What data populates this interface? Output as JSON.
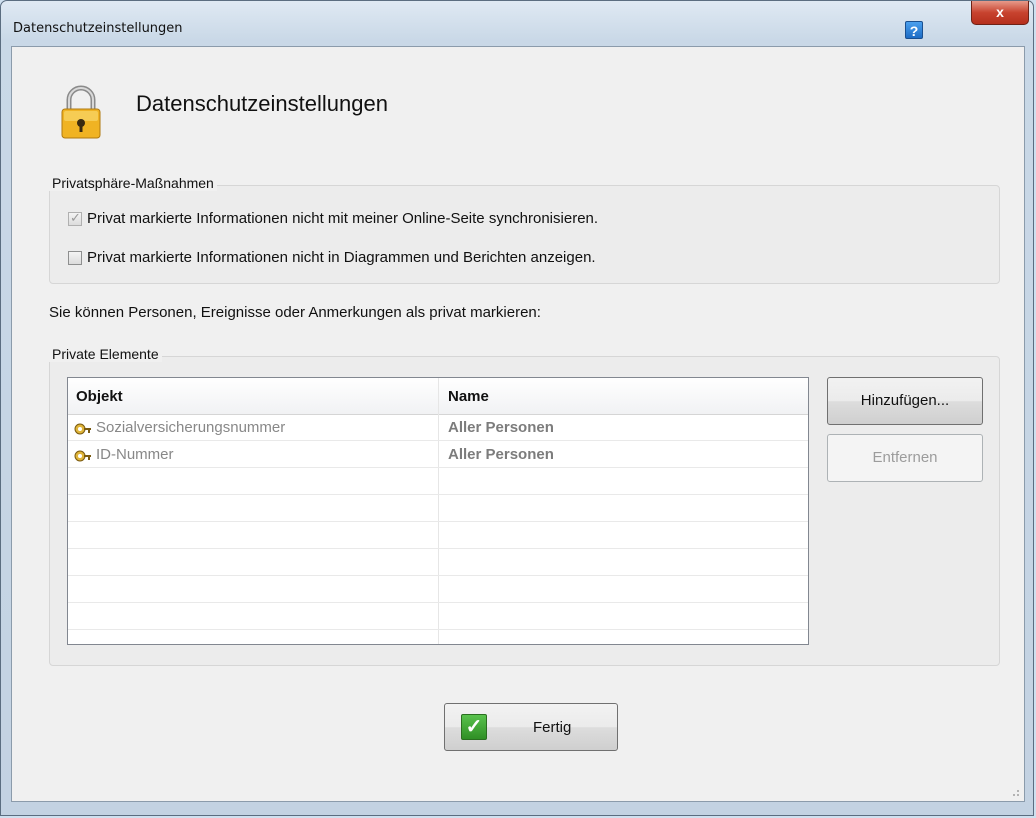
{
  "window": {
    "title": "Datenschutzeinstellungen",
    "help_label": "?",
    "close_label": "x"
  },
  "header": {
    "title": "Datenschutzeinstellungen",
    "icon": "lock-icon"
  },
  "privacy_group": {
    "legend": "Privatsphäre-Maßnahmen",
    "options": [
      {
        "label": "Privat markierte Informationen nicht mit meiner Online-Seite synchronisieren.",
        "checked": true,
        "disabled": true
      },
      {
        "label": "Privat markierte Informationen nicht in Diagrammen und Berichten anzeigen.",
        "checked": false,
        "disabled": false
      }
    ]
  },
  "description": "Sie können Personen, Ereignisse oder Anmerkungen als privat markieren:",
  "private_group": {
    "legend": "Private Elemente",
    "columns": [
      "Objekt",
      "Name"
    ],
    "rows": [
      {
        "object": "Sozialversicherungsnummer",
        "name": "Aller Personen",
        "icon": "key-icon"
      },
      {
        "object": "ID-Nummer",
        "name": "Aller Personen",
        "icon": "key-icon"
      }
    ],
    "add_button": "Hinzufügen...",
    "remove_button": "Entfernen"
  },
  "footer": {
    "done_button": "Fertig"
  }
}
